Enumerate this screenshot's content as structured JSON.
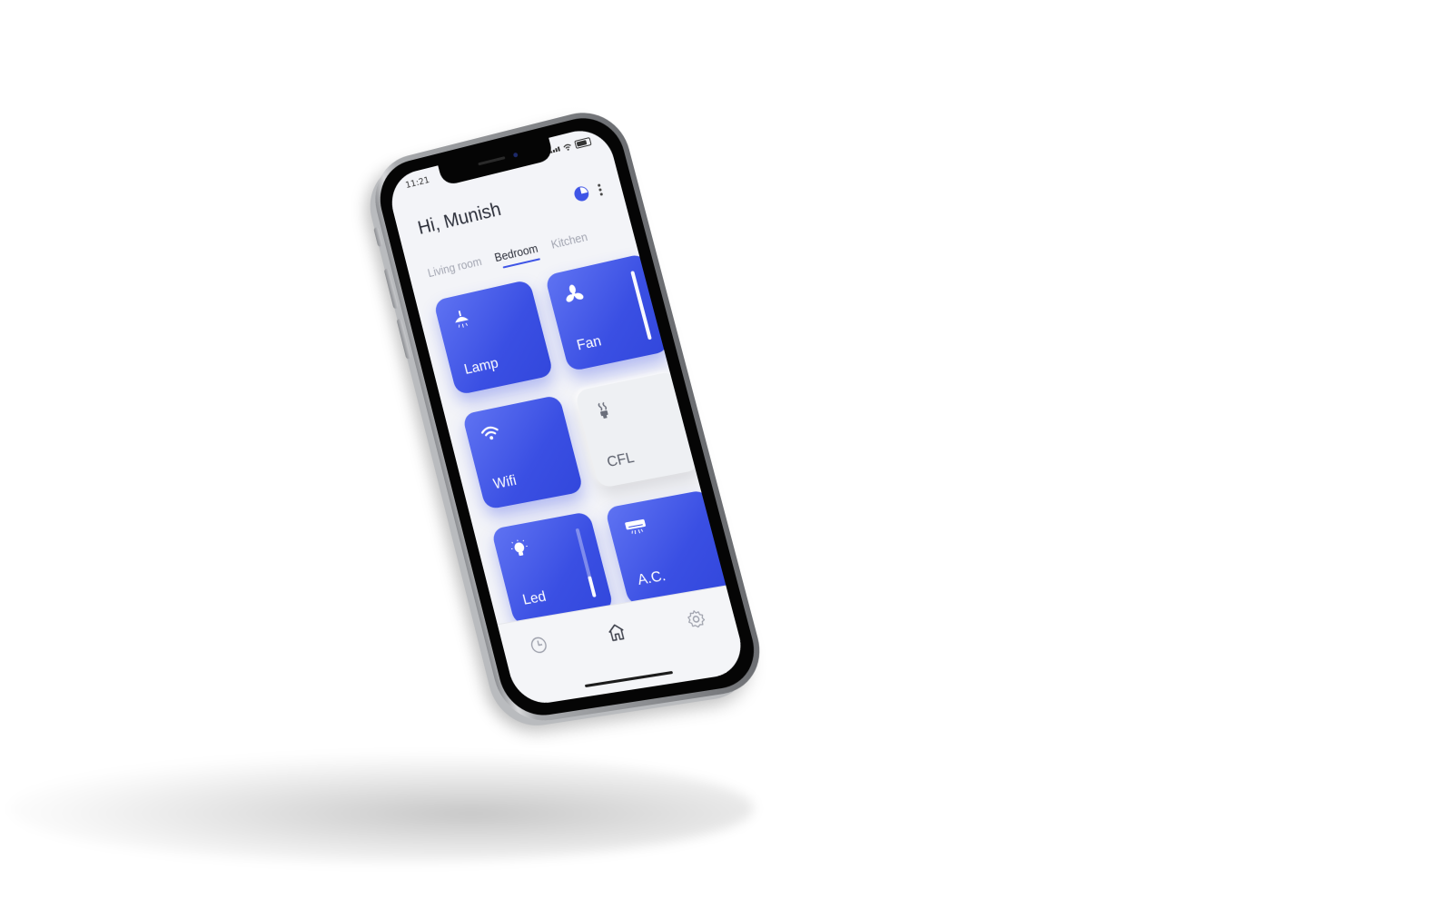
{
  "status_bar": {
    "time": "11:21"
  },
  "header": {
    "greeting": "Hi, Munish",
    "actions": [
      "pie-chart-icon",
      "more-vertical-icon"
    ]
  },
  "tabs": [
    {
      "label": "Living room",
      "active": false
    },
    {
      "label": "Bedroom",
      "active": true
    },
    {
      "label": "Kitchen",
      "active": false
    }
  ],
  "devices": [
    {
      "label": "Lamp",
      "icon": "lamp-icon",
      "on": true
    },
    {
      "label": "Fan",
      "icon": "fan-icon",
      "on": true,
      "level": 1.0
    },
    {
      "label": "Wifi",
      "icon": "wifi-icon",
      "on": true
    },
    {
      "label": "CFL",
      "icon": "cfl-bulb-icon",
      "on": false
    },
    {
      "label": "Led",
      "icon": "bulb-icon",
      "on": true,
      "level": 0.3
    },
    {
      "label": "A.C.",
      "icon": "air-conditioner-icon",
      "on": true
    }
  ],
  "bottom_nav": [
    {
      "icon": "clock-icon",
      "active": false
    },
    {
      "icon": "home-icon",
      "active": true
    },
    {
      "icon": "gear-icon",
      "active": false
    }
  ],
  "colors": {
    "accent": "#3f55e6",
    "tile_gradient_start": "#5f73f2",
    "tile_gradient_end": "#3247dc",
    "screen_bg": "#f3f4f8",
    "off_tile_bg": "#eef0f3"
  }
}
